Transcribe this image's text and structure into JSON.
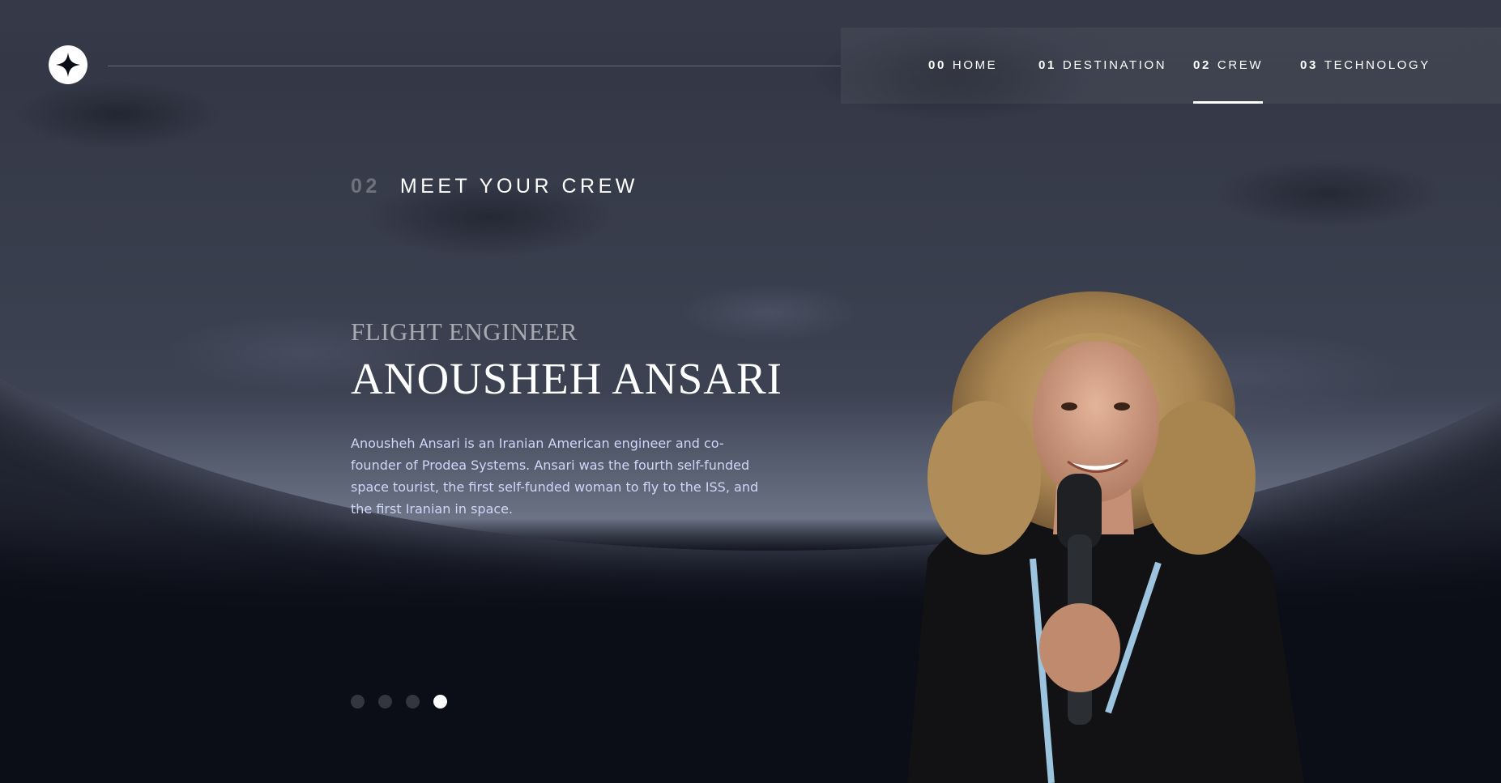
{
  "nav": {
    "items": [
      {
        "num": "00",
        "label": "HOME"
      },
      {
        "num": "01",
        "label": "DESTINATION"
      },
      {
        "num": "02",
        "label": "CREW"
      },
      {
        "num": "03",
        "label": "TECHNOLOGY"
      }
    ],
    "active_index": 2
  },
  "section": {
    "num": "02",
    "title": "MEET YOUR CREW"
  },
  "crew": {
    "role": "FLIGHT ENGINEER",
    "name": "ANOUSHEH ANSARI",
    "bio": "Anousheh Ansari is an Iranian American engineer and co-founder of Prodea Systems. Ansari was the fourth self-funded space tourist, the first self-funded woman to fly to the ISS, and the first Iranian in space."
  },
  "pagination": {
    "count": 4,
    "active_index": 3
  },
  "colors": {
    "background": "#0b0d17",
    "text": "#ffffff",
    "bio_text": "#d0d6f9"
  },
  "icons": {
    "logo": "four-point-star-icon"
  }
}
